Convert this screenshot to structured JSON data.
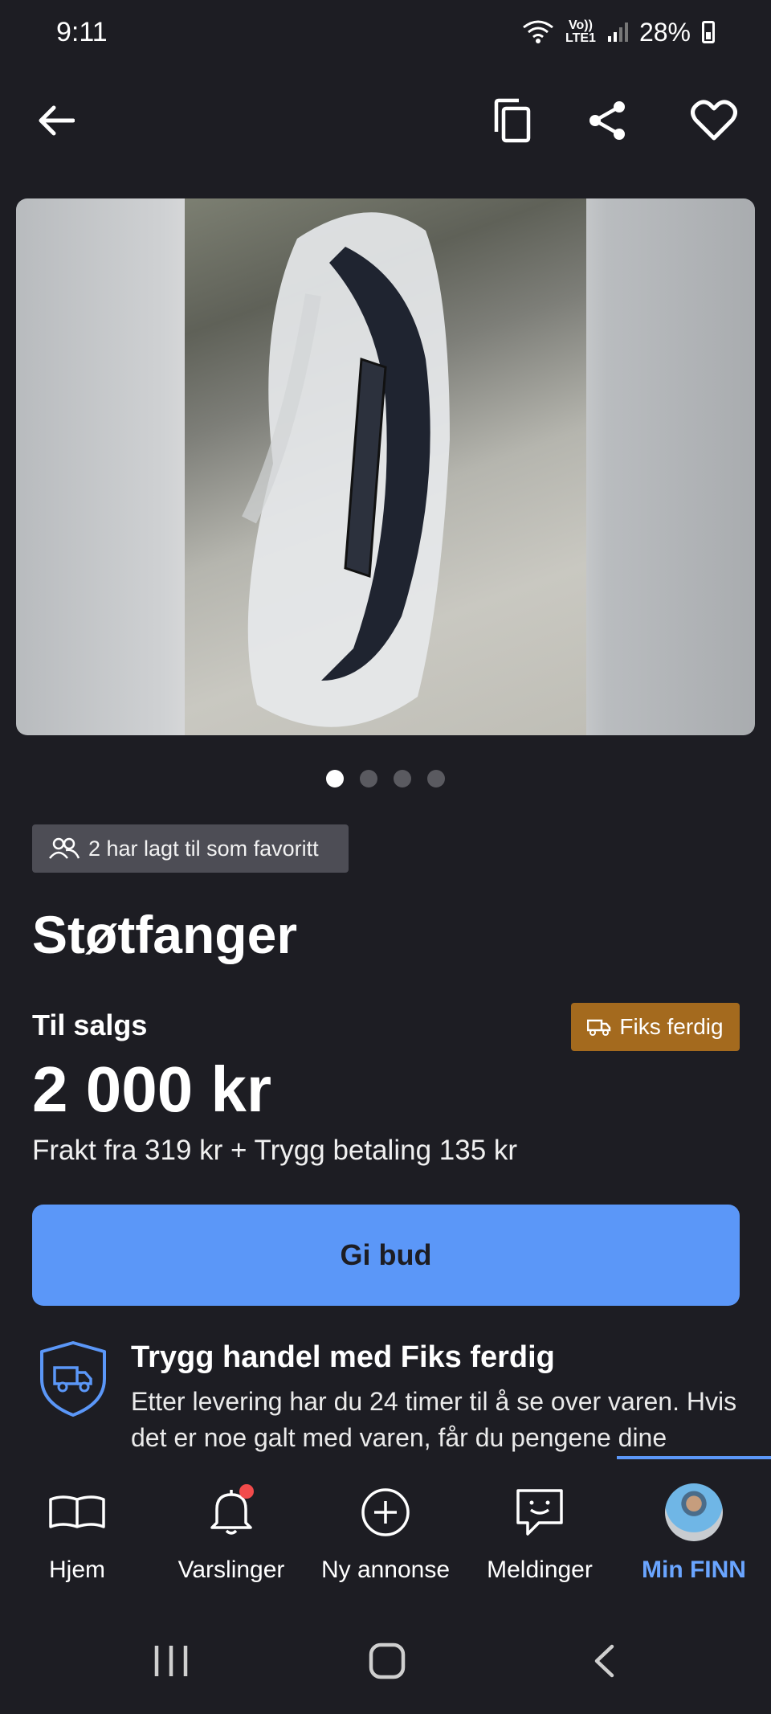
{
  "status": {
    "time": "9:11",
    "network_top": "Vo))",
    "network_bottom": "LTE1",
    "battery": "28%"
  },
  "listing": {
    "favorites_badge": "2 har lagt til som favoritt",
    "title": "Støtfanger",
    "sale_label": "Til salgs",
    "fiks_badge": "Fiks ferdig",
    "price": "2 000 kr",
    "shipping": "Frakt fra 319 kr + Trygg betaling 135 kr",
    "bid_button": "Gi bud",
    "image_count": 4,
    "active_image": 1
  },
  "safe_trade": {
    "title": "Trygg handel med Fiks ferdig",
    "text": "Etter levering har du 24 timer til å se over varen. Hvis det er noe galt med varen, får du pengene dine"
  },
  "bottom_nav": [
    {
      "label": "Hjem",
      "icon": "book-icon"
    },
    {
      "label": "Varslinger",
      "icon": "bell-icon"
    },
    {
      "label": "Ny annonse",
      "icon": "plus-circle-icon"
    },
    {
      "label": "Meldinger",
      "icon": "chat-icon"
    },
    {
      "label": "Min FINN",
      "icon": "avatar"
    }
  ],
  "colors": {
    "background": "#1d1d23",
    "accent": "#5b97f8",
    "fiks_badge": "#a46a1e",
    "active_nav": "#6aa5ff",
    "notification": "#f24b4b"
  }
}
